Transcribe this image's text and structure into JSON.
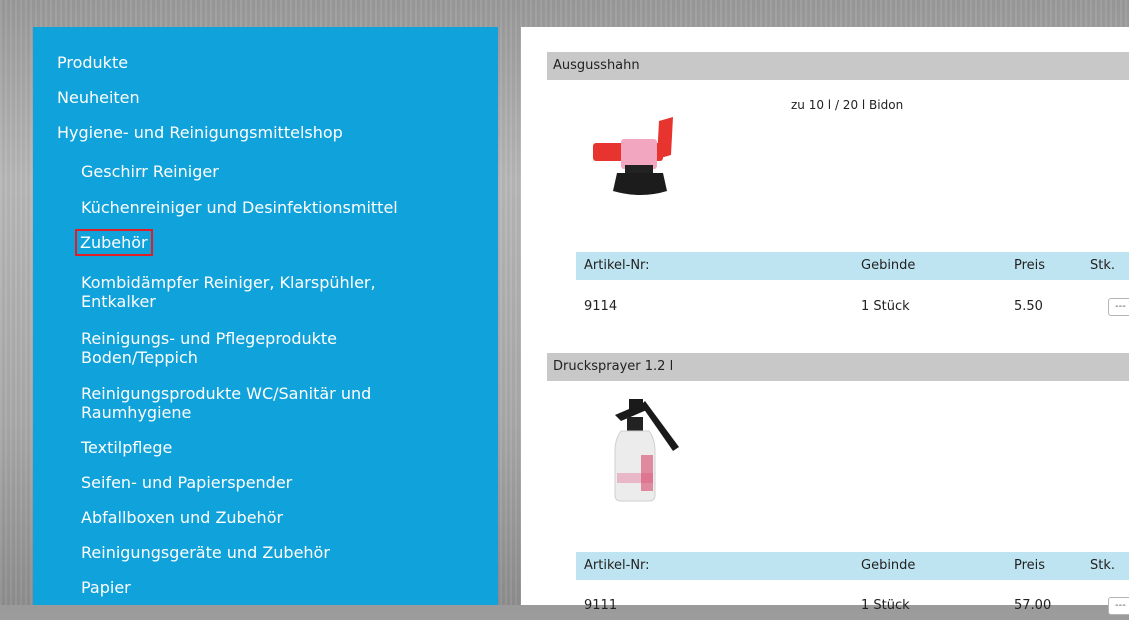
{
  "sidebar": {
    "items": [
      {
        "label": "Produkte"
      },
      {
        "label": "Neuheiten"
      },
      {
        "label": "Hygiene- und Reinigungsmittelshop"
      },
      {
        "label": "Geschirr Reiniger"
      },
      {
        "label": "Küchenreiniger und Desinfektionsmittel"
      },
      {
        "label": "Zubehör"
      },
      {
        "label": "Kombidämpfer Reiniger, Klarspühler, Entkalker"
      },
      {
        "label": "Reinigungs- und Pflegeprodukte Boden/Teppich"
      },
      {
        "label": "Reinigungsprodukte WC/Sanitär und Raumhygiene"
      },
      {
        "label": "Textilpflege"
      },
      {
        "label": "Seifen- und Papierspender"
      },
      {
        "label": "Abfallboxen und Zubehör"
      },
      {
        "label": "Reinigungsgeräte und Zubehör"
      },
      {
        "label": "Papier"
      }
    ],
    "active_item": "Zubehör",
    "active_color": "#e01e26",
    "background_color": "#10a2da"
  },
  "table_headers": {
    "artikel": "Artikel-Nr:",
    "gebinde": "Gebinde",
    "preis": "Preis",
    "stk": "Stk."
  },
  "products": [
    {
      "name": "Ausgusshahn",
      "description": "zu 10 l / 20 l Bidon",
      "artikel_nr": "9114",
      "gebinde": "1 Stück",
      "preis": "5.50",
      "qty": "---"
    },
    {
      "name": "Drucksprayer 1.2 l",
      "description": "",
      "artikel_nr": "9111",
      "gebinde": "1 Stück",
      "preis": "57.00",
      "qty": "---"
    }
  ],
  "colors": {
    "header_gray": "#c8c8c8",
    "table_head_blue": "#bfe4f1"
  }
}
